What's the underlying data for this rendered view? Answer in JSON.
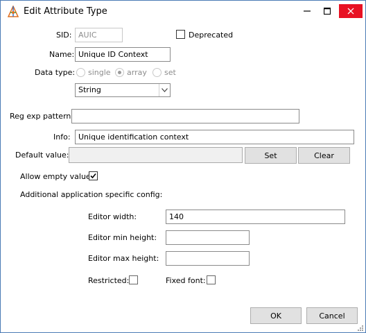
{
  "window": {
    "title": "Edit Attribute Type"
  },
  "form": {
    "sid_label": "SID:",
    "sid_value": "AUIC",
    "deprecated_label": "Deprecated",
    "name_label": "Name:",
    "name_value": "Unique ID Context",
    "data_type_label": "Data type:",
    "data_type_options": [
      "single",
      "array",
      "set"
    ],
    "data_type_selected": "array",
    "data_type_format": "String",
    "regexp_label": "Reg exp pattern:",
    "regexp_value": "",
    "info_label": "Info:",
    "info_value": "Unique identification context",
    "default_value_label": "Default value:",
    "default_value": "",
    "set_button": "Set",
    "clear_button": "Clear",
    "allow_empty_label": "Allow empty value",
    "allow_empty_checked": true,
    "app_config_label": "Additional application specific config:",
    "editor_width_label": "Editor width:",
    "editor_width_value": "140",
    "editor_min_height_label": "Editor min height:",
    "editor_min_height_value": "",
    "editor_max_height_label": "Editor max height:",
    "editor_max_height_value": "",
    "restricted_label": "Restricted:",
    "fixed_font_label": "Fixed font:"
  },
  "footer": {
    "ok_label": "OK",
    "cancel_label": "Cancel"
  },
  "colors": {
    "close_button": "#e81123",
    "border": "#4a7ab5"
  }
}
